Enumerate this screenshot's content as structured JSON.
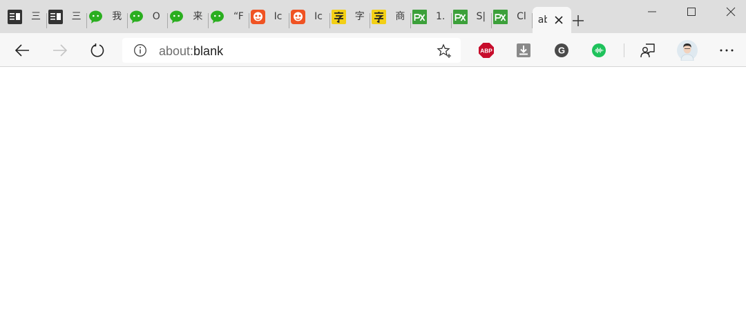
{
  "tabs": [
    {
      "label": "三",
      "favicon": "reader-app-icon",
      "color": "#333333"
    },
    {
      "label": "三",
      "favicon": "reader-app-icon",
      "color": "#333333"
    },
    {
      "label": "我",
      "favicon": "wechat-icon",
      "color": "#2aae1f"
    },
    {
      "label": "O",
      "favicon": "wechat-icon",
      "color": "#2aae1f"
    },
    {
      "label": "来",
      "favicon": "wechat-icon",
      "color": "#2aae1f"
    },
    {
      "label": "“F",
      "favicon": "wechat-icon",
      "color": "#2aae1f"
    },
    {
      "label": "Ic",
      "favicon": "iconfont-icon",
      "color": "#f05323"
    },
    {
      "label": "Ic",
      "favicon": "iconfont-icon",
      "color": "#f05323"
    },
    {
      "label": "字",
      "favicon": "zi-font-icon",
      "color": "#f2cf15"
    },
    {
      "label": "商",
      "favicon": "zi-font-icon",
      "color": "#f2cf15"
    },
    {
      "label": "1.",
      "favicon": "px-icon",
      "color": "#3ca03a"
    },
    {
      "label": "S|",
      "favicon": "px-icon",
      "color": "#3ca03a"
    },
    {
      "label": "Cl",
      "favicon": "px-icon",
      "color": "#3ca03a"
    }
  ],
  "active_tab": {
    "label": "ab"
  },
  "address_bar": {
    "scheme": "about:",
    "path": "blank"
  },
  "extensions": [
    {
      "name": "adblock-plus-icon",
      "label": "ABP",
      "color": "#c70d2c"
    },
    {
      "name": "download-icon",
      "color": "#8a8a8a"
    },
    {
      "name": "grammarly-icon",
      "label": "G",
      "color": "#4a4a4a"
    },
    {
      "name": "audio-wave-icon",
      "color": "#1ec25b"
    }
  ],
  "colors": {
    "tabstrip": "#dedede",
    "toolbar": "#f7f7f7",
    "page": "#ffffff"
  }
}
